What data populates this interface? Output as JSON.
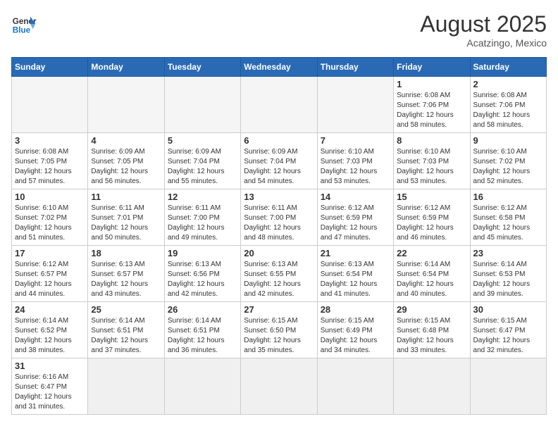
{
  "header": {
    "logo_general": "General",
    "logo_blue": "Blue",
    "month_title": "August 2025",
    "location": "Acatzingo, Mexico"
  },
  "days_of_week": [
    "Sunday",
    "Monday",
    "Tuesday",
    "Wednesday",
    "Thursday",
    "Friday",
    "Saturday"
  ],
  "weeks": [
    [
      {
        "day": "",
        "info": ""
      },
      {
        "day": "",
        "info": ""
      },
      {
        "day": "",
        "info": ""
      },
      {
        "day": "",
        "info": ""
      },
      {
        "day": "",
        "info": ""
      },
      {
        "day": "1",
        "info": "Sunrise: 6:08 AM\nSunset: 7:06 PM\nDaylight: 12 hours\nand 58 minutes."
      },
      {
        "day": "2",
        "info": "Sunrise: 6:08 AM\nSunset: 7:06 PM\nDaylight: 12 hours\nand 58 minutes."
      }
    ],
    [
      {
        "day": "3",
        "info": "Sunrise: 6:08 AM\nSunset: 7:05 PM\nDaylight: 12 hours\nand 57 minutes."
      },
      {
        "day": "4",
        "info": "Sunrise: 6:09 AM\nSunset: 7:05 PM\nDaylight: 12 hours\nand 56 minutes."
      },
      {
        "day": "5",
        "info": "Sunrise: 6:09 AM\nSunset: 7:04 PM\nDaylight: 12 hours\nand 55 minutes."
      },
      {
        "day": "6",
        "info": "Sunrise: 6:09 AM\nSunset: 7:04 PM\nDaylight: 12 hours\nand 54 minutes."
      },
      {
        "day": "7",
        "info": "Sunrise: 6:10 AM\nSunset: 7:03 PM\nDaylight: 12 hours\nand 53 minutes."
      },
      {
        "day": "8",
        "info": "Sunrise: 6:10 AM\nSunset: 7:03 PM\nDaylight: 12 hours\nand 53 minutes."
      },
      {
        "day": "9",
        "info": "Sunrise: 6:10 AM\nSunset: 7:02 PM\nDaylight: 12 hours\nand 52 minutes."
      }
    ],
    [
      {
        "day": "10",
        "info": "Sunrise: 6:10 AM\nSunset: 7:02 PM\nDaylight: 12 hours\nand 51 minutes."
      },
      {
        "day": "11",
        "info": "Sunrise: 6:11 AM\nSunset: 7:01 PM\nDaylight: 12 hours\nand 50 minutes."
      },
      {
        "day": "12",
        "info": "Sunrise: 6:11 AM\nSunset: 7:00 PM\nDaylight: 12 hours\nand 49 minutes."
      },
      {
        "day": "13",
        "info": "Sunrise: 6:11 AM\nSunset: 7:00 PM\nDaylight: 12 hours\nand 48 minutes."
      },
      {
        "day": "14",
        "info": "Sunrise: 6:12 AM\nSunset: 6:59 PM\nDaylight: 12 hours\nand 47 minutes."
      },
      {
        "day": "15",
        "info": "Sunrise: 6:12 AM\nSunset: 6:59 PM\nDaylight: 12 hours\nand 46 minutes."
      },
      {
        "day": "16",
        "info": "Sunrise: 6:12 AM\nSunset: 6:58 PM\nDaylight: 12 hours\nand 45 minutes."
      }
    ],
    [
      {
        "day": "17",
        "info": "Sunrise: 6:12 AM\nSunset: 6:57 PM\nDaylight: 12 hours\nand 44 minutes."
      },
      {
        "day": "18",
        "info": "Sunrise: 6:13 AM\nSunset: 6:57 PM\nDaylight: 12 hours\nand 43 minutes."
      },
      {
        "day": "19",
        "info": "Sunrise: 6:13 AM\nSunset: 6:56 PM\nDaylight: 12 hours\nand 42 minutes."
      },
      {
        "day": "20",
        "info": "Sunrise: 6:13 AM\nSunset: 6:55 PM\nDaylight: 12 hours\nand 42 minutes."
      },
      {
        "day": "21",
        "info": "Sunrise: 6:13 AM\nSunset: 6:54 PM\nDaylight: 12 hours\nand 41 minutes."
      },
      {
        "day": "22",
        "info": "Sunrise: 6:14 AM\nSunset: 6:54 PM\nDaylight: 12 hours\nand 40 minutes."
      },
      {
        "day": "23",
        "info": "Sunrise: 6:14 AM\nSunset: 6:53 PM\nDaylight: 12 hours\nand 39 minutes."
      }
    ],
    [
      {
        "day": "24",
        "info": "Sunrise: 6:14 AM\nSunset: 6:52 PM\nDaylight: 12 hours\nand 38 minutes."
      },
      {
        "day": "25",
        "info": "Sunrise: 6:14 AM\nSunset: 6:51 PM\nDaylight: 12 hours\nand 37 minutes."
      },
      {
        "day": "26",
        "info": "Sunrise: 6:14 AM\nSunset: 6:51 PM\nDaylight: 12 hours\nand 36 minutes."
      },
      {
        "day": "27",
        "info": "Sunrise: 6:15 AM\nSunset: 6:50 PM\nDaylight: 12 hours\nand 35 minutes."
      },
      {
        "day": "28",
        "info": "Sunrise: 6:15 AM\nSunset: 6:49 PM\nDaylight: 12 hours\nand 34 minutes."
      },
      {
        "day": "29",
        "info": "Sunrise: 6:15 AM\nSunset: 6:48 PM\nDaylight: 12 hours\nand 33 minutes."
      },
      {
        "day": "30",
        "info": "Sunrise: 6:15 AM\nSunset: 6:47 PM\nDaylight: 12 hours\nand 32 minutes."
      }
    ],
    [
      {
        "day": "31",
        "info": "Sunrise: 6:16 AM\nSunset: 6:47 PM\nDaylight: 12 hours\nand 31 minutes."
      },
      {
        "day": "",
        "info": ""
      },
      {
        "day": "",
        "info": ""
      },
      {
        "day": "",
        "info": ""
      },
      {
        "day": "",
        "info": ""
      },
      {
        "day": "",
        "info": ""
      },
      {
        "day": "",
        "info": ""
      }
    ]
  ]
}
